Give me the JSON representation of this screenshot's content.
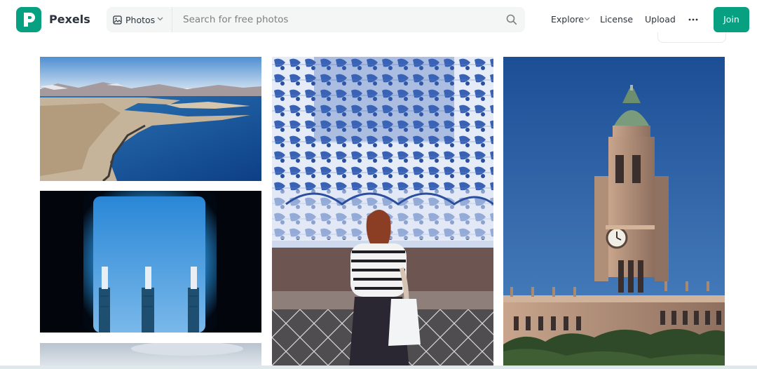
{
  "header": {
    "logo_text": "Pexels",
    "search": {
      "type_label": "Photos",
      "placeholder": "Search for free photos"
    },
    "nav": {
      "explore": "Explore",
      "license": "License",
      "upload": "Upload"
    },
    "join_label": "Join"
  },
  "colors": {
    "brand": "#07a081",
    "text": "#2c343e",
    "search_bg": "#f4f5f5"
  },
  "icons": {
    "logo": "pexels-logo-icon",
    "search_type": "image-icon",
    "search": "search-icon",
    "more": "more-horizontal-icon",
    "chevron": "chevron-down-icon"
  },
  "photos": [
    {
      "subject": "lake-aerial"
    },
    {
      "subject": "window-chimneys"
    },
    {
      "subject": "azulejo-tiles-woman"
    },
    {
      "subject": "clock-tower"
    },
    {
      "subject": "sky"
    }
  ]
}
